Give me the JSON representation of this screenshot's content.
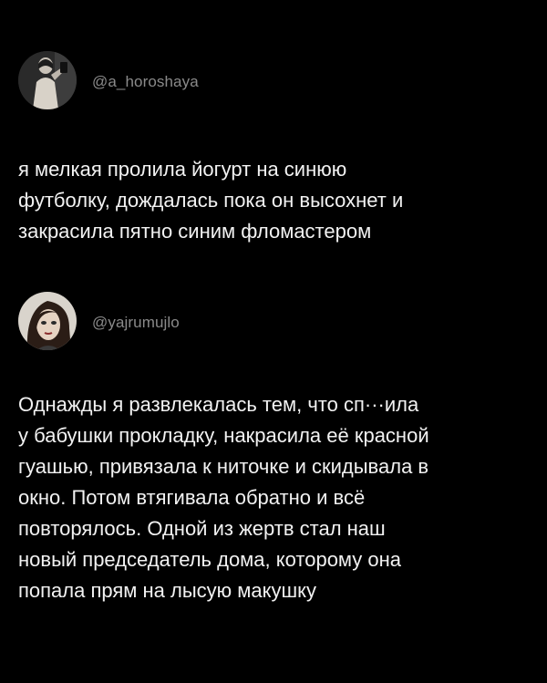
{
  "posts": [
    {
      "handle": "@a_horoshaya",
      "avatar": "avatar-photo-woman-mirror-selfie",
      "lines": [
        "я мелкая пролила йогурт на синюю",
        "футболку, дождалась пока он высохнет и",
        "закрасила пятно синим фломастером"
      ]
    },
    {
      "handle": "@yajrumujlo",
      "avatar": "avatar-illustration-dark-haired-woman",
      "lines": [
        "Однажды я развлекалась тем, что сп···ила",
        "у бабушки прокладку, накрасила её красной",
        "гуашью, привязала к ниточке и скидывала в",
        "окно. Потом втягивала обратно и всё",
        "повторялось. Одной из жертв стал наш",
        "новый председатель дома, которому она",
        "попала прям на лысую макушку"
      ]
    }
  ],
  "colors": {
    "background": "#000000",
    "text": "#f2f2f2",
    "handle": "#8a8a8a"
  }
}
